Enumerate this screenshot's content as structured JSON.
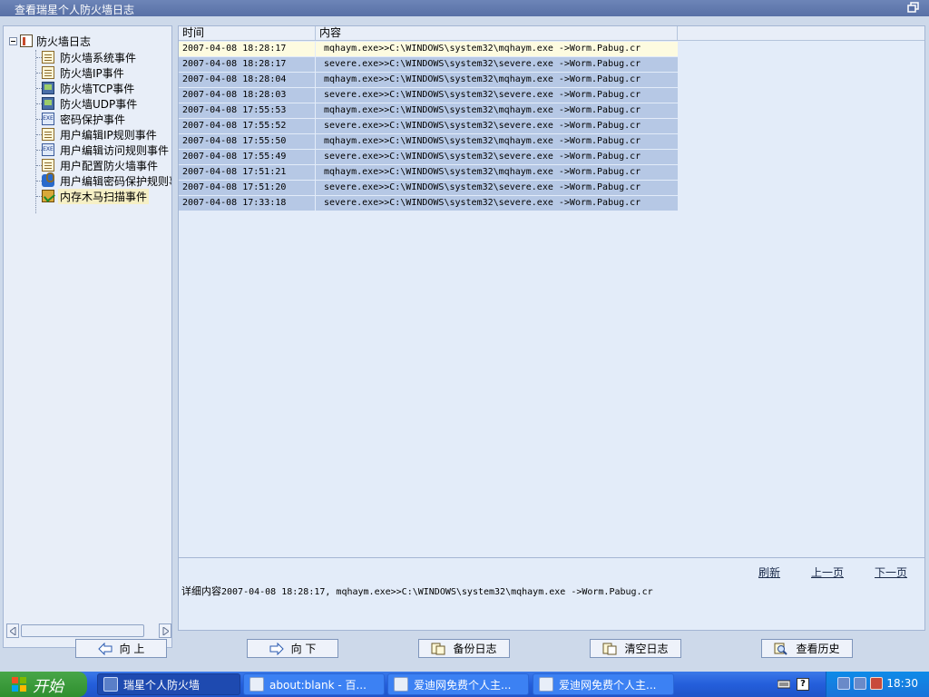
{
  "window": {
    "title": "查看瑞星个人防火墙日志"
  },
  "tree": {
    "root": "防火墙日志",
    "items": [
      {
        "label": "防火墙系统事件",
        "icon": "document-icon"
      },
      {
        "label": "防火墙IP事件",
        "icon": "ip-document-icon"
      },
      {
        "label": "防火墙TCP事件",
        "icon": "computer-icon"
      },
      {
        "label": "防火墙UDP事件",
        "icon": "computer-icon"
      },
      {
        "label": "密码保护事件",
        "icon": "exe-icon"
      },
      {
        "label": "用户编辑IP规则事件",
        "icon": "ip-document-icon"
      },
      {
        "label": "用户编辑访问规则事件",
        "icon": "exe-edit-icon"
      },
      {
        "label": "用户配置防火墙事件",
        "icon": "config-icon"
      },
      {
        "label": "用户编辑密码保护规则事件",
        "icon": "key-icon"
      },
      {
        "label": "内存木马扫描事件",
        "icon": "scan-icon"
      }
    ],
    "selected_index": 9
  },
  "log": {
    "headers": {
      "time": "时间",
      "content": "内容"
    },
    "rows": [
      {
        "time": "2007-04-08 18:28:17",
        "content": "mqhaym.exe>>C:\\WINDOWS\\system32\\mqhaym.exe ->Worm.Pabug.cr"
      },
      {
        "time": "2007-04-08 18:28:17",
        "content": "severe.exe>>C:\\WINDOWS\\system32\\severe.exe ->Worm.Pabug.cr"
      },
      {
        "time": "2007-04-08 18:28:04",
        "content": "mqhaym.exe>>C:\\WINDOWS\\system32\\mqhaym.exe ->Worm.Pabug.cr"
      },
      {
        "time": "2007-04-08 18:28:03",
        "content": "severe.exe>>C:\\WINDOWS\\system32\\severe.exe ->Worm.Pabug.cr"
      },
      {
        "time": "2007-04-08 17:55:53",
        "content": "mqhaym.exe>>C:\\WINDOWS\\system32\\mqhaym.exe ->Worm.Pabug.cr"
      },
      {
        "time": "2007-04-08 17:55:52",
        "content": "severe.exe>>C:\\WINDOWS\\system32\\severe.exe ->Worm.Pabug.cr"
      },
      {
        "time": "2007-04-08 17:55:50",
        "content": "mqhaym.exe>>C:\\WINDOWS\\system32\\mqhaym.exe ->Worm.Pabug.cr"
      },
      {
        "time": "2007-04-08 17:55:49",
        "content": "severe.exe>>C:\\WINDOWS\\system32\\severe.exe ->Worm.Pabug.cr"
      },
      {
        "time": "2007-04-08 17:51:21",
        "content": "mqhaym.exe>>C:\\WINDOWS\\system32\\mqhaym.exe ->Worm.Pabug.cr"
      },
      {
        "time": "2007-04-08 17:51:20",
        "content": "severe.exe>>C:\\WINDOWS\\system32\\severe.exe ->Worm.Pabug.cr"
      },
      {
        "time": "2007-04-08 17:33:18",
        "content": "severe.exe>>C:\\WINDOWS\\system32\\severe.exe ->Worm.Pabug.cr"
      }
    ],
    "selected_index": 0
  },
  "detail": {
    "label": "详细内容",
    "text": "2007-04-08 18:28:17, mqhaym.exe>>C:\\WINDOWS\\system32\\mqhaym.exe ->Worm.Pabug.cr"
  },
  "nav": {
    "refresh": "刷新",
    "prev_page": "上一页",
    "next_page": "下一页"
  },
  "buttons": {
    "up": "向 上",
    "down": "向 下",
    "backup": "备份日志",
    "clear": "清空日志",
    "history": "查看历史"
  },
  "taskbar": {
    "start": "开始",
    "tasks": [
      {
        "label": "瑞星个人防火墙",
        "active": true
      },
      {
        "label": "about:blank - 百...",
        "active": false
      },
      {
        "label": "爱迪网免费个人主...",
        "active": false
      },
      {
        "label": "爱迪网免费个人主...",
        "active": false
      }
    ],
    "clock": "18:30"
  },
  "colors": {
    "row_bg": "#b6c8e5",
    "row_selected_bg": "#fdfbe0",
    "panel_bg": "#e3ecf9",
    "titlebar": "#5870a6",
    "taskbar": "#245edb"
  }
}
